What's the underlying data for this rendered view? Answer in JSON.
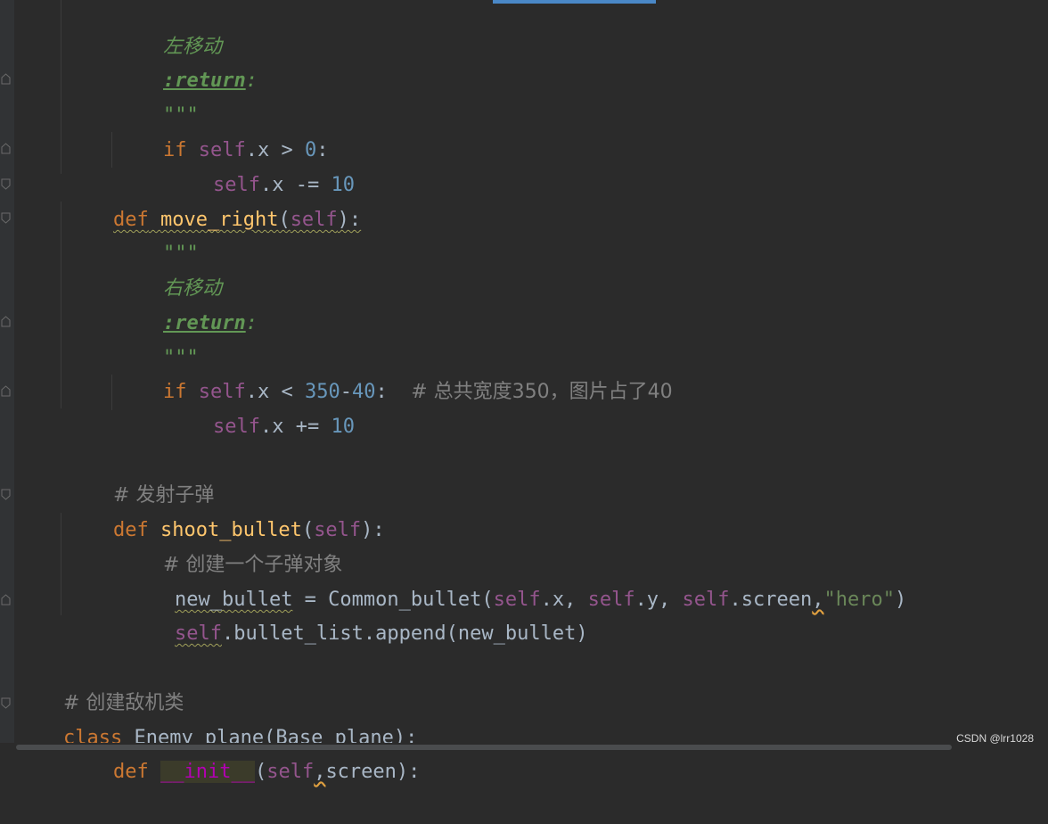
{
  "lines": {
    "l1": "左移动",
    "l2_tag": ":return",
    "l2_colon": ":",
    "l3": "\"\"\"",
    "l4_if": "if",
    "l4_self": "self",
    "l4_rest": ".x > ",
    "l4_num": "0",
    "l4_colon": ":",
    "l5_self": "self",
    "l5_rest": ".x -= ",
    "l5_num": "10",
    "l6_def": "def",
    "l6_name": "move_right",
    "l6_open": "(",
    "l6_self": "self",
    "l6_close": "):",
    "l7": "\"\"\"",
    "l8": "右移动",
    "l9_tag": ":return",
    "l9_colon": ":",
    "l10": "\"\"\"",
    "l11_if": "if",
    "l11_self": "self",
    "l11_rest": ".x < ",
    "l11_num1": "350",
    "l11_minus": "-",
    "l11_num2": "40",
    "l11_colon": ":  ",
    "l11_comment": "# 总共宽度350，图片占了40",
    "l12_self": "self",
    "l12_rest": ".x += ",
    "l12_num": "10",
    "l13_comment": "# 发射子弹",
    "l14_def": "def",
    "l14_name": "shoot_bullet",
    "l14_open": "(",
    "l14_self": "self",
    "l14_close": "):",
    "l15_comment": "# 创建一个子弹对象",
    "l16_var": "new_bullet",
    "l16_a": " = Common_bullet(",
    "l16_self1": "self",
    "l16_b": ".x, ",
    "l16_self2": "self",
    "l16_c": ".y, ",
    "l16_self3": "self",
    "l16_d": ".screen",
    "l16_comma": ",",
    "l16_str": "\"hero\"",
    "l16_e": ")",
    "l17_self": "self",
    "l17_rest": ".bullet_list.append(new_bullet)",
    "l18_comment": "# 创建敌机类",
    "l19_class": "class",
    "l19_rest": " Enemy_plane(Base_plane):",
    "l20_def": "def",
    "l20_init": "__init__",
    "l20_open": "(",
    "l20_self": "self",
    "l20_comma": ",",
    "l20_rest": "screen):"
  },
  "watermark": "CSDN @lrr1028",
  "colors": {
    "background": "#2b2b2b",
    "keyword": "#cc7832",
    "self": "#94558d",
    "number": "#6897bb",
    "function": "#ffc66d",
    "string": "#6a8759",
    "docstring": "#629755",
    "comment": "#808080",
    "default": "#a9b7c6"
  }
}
